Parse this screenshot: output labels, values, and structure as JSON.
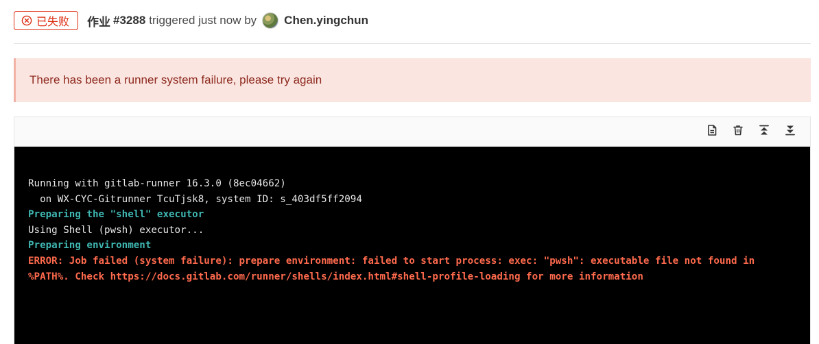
{
  "header": {
    "status_label": "已失败",
    "job_prefix": "作业",
    "job_number": "#3288",
    "trigger_text": "triggered just now by",
    "author": "Chen.yingchun"
  },
  "alert": {
    "message": "There has been a runner system failure, please try again"
  },
  "toolbar": {
    "icons": [
      "raw-log-icon",
      "erase-log-icon",
      "scroll-top-icon",
      "scroll-bottom-icon"
    ]
  },
  "log": {
    "lines": [
      {
        "text": "Running with gitlab-runner 16.3.0 (8ec04662)",
        "style": "normal"
      },
      {
        "text": "  on WX-CYC-Gitrunner TcuTjsk8, system ID: s_403df5ff2094",
        "style": "normal"
      },
      {
        "text": "Preparing the \"shell\" executor",
        "style": "section"
      },
      {
        "text": "Using Shell (pwsh) executor...",
        "style": "normal"
      },
      {
        "text": "Preparing environment",
        "style": "section"
      },
      {
        "text": "ERROR: Job failed (system failure): prepare environment: failed to start process: exec: \"pwsh\": executable file not found in",
        "style": "error"
      },
      {
        "text": "%PATH%. Check https://docs.gitlab.com/runner/shells/index.html#shell-profile-loading for more information",
        "style": "error"
      }
    ]
  },
  "colors": {
    "failed": "#dd2b0e",
    "alert_bg": "#fbe5e1",
    "alert_text": "#8d2a1e",
    "log_bg": "#000000",
    "log_section": "#3fb6b1",
    "log_error": "#ff6a4d"
  }
}
